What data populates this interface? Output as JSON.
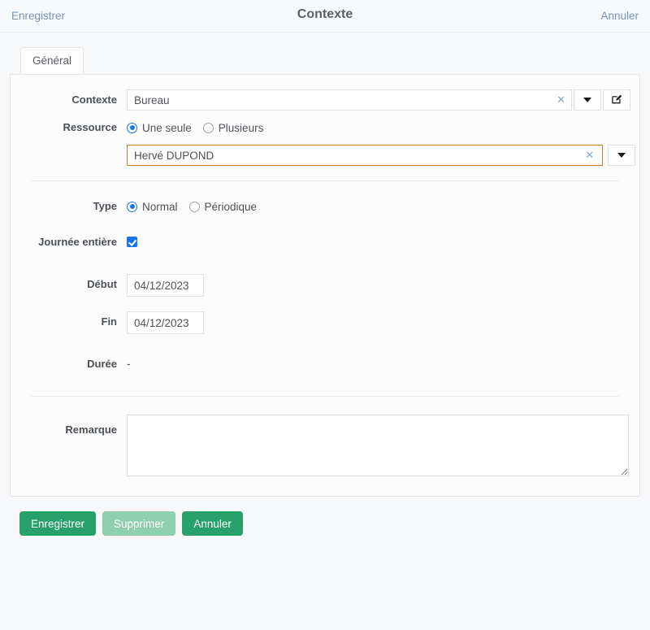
{
  "header": {
    "save_link": "Enregistrer",
    "title": "Contexte",
    "cancel_link": "Annuler"
  },
  "tabs": [
    {
      "label": "Général",
      "active": true
    }
  ],
  "form": {
    "contexte": {
      "label": "Contexte",
      "value": "Bureau",
      "clear_icon": "clear-x-icon",
      "dropdown_icon": "chevron-down-icon",
      "edit_icon": "edit-pencil-icon"
    },
    "ressource": {
      "label": "Ressource",
      "options": [
        {
          "label": "Une seule",
          "selected": true
        },
        {
          "label": "Plusieurs",
          "selected": false
        }
      ],
      "value": "Hervé DUPOND",
      "placeholder": "",
      "clear_icon": "clear-x-icon",
      "dropdown_icon": "chevron-down-icon",
      "focus_border_color": "#c87f29"
    },
    "type": {
      "label": "Type",
      "options": [
        {
          "label": "Normal",
          "selected": true
        },
        {
          "label": "Périodique",
          "selected": false
        }
      ]
    },
    "journee_entiere": {
      "label": "Journée entière",
      "checked": true,
      "accent_color": "#1a73e8"
    },
    "debut": {
      "label": "Début",
      "value": "04/12/2023"
    },
    "fin": {
      "label": "Fin",
      "value": "04/12/2023"
    },
    "duree": {
      "label": "Durée",
      "value": "-"
    },
    "remarque": {
      "label": "Remarque",
      "value": "",
      "placeholder": ""
    }
  },
  "footer": {
    "buttons": [
      {
        "label": "Enregistrer",
        "style": "primary"
      },
      {
        "label": "Supprimer",
        "style": "muted"
      },
      {
        "label": "Annuler",
        "style": "primary"
      }
    ]
  },
  "colors": {
    "page_background": "#f7f8f9",
    "panel_background": "#fcfcfd",
    "accent_blue": "#1a73e8",
    "link_blue": "#7593b8",
    "button_green": "#27a06a",
    "button_green_disabled": "#8fcfb0",
    "focus_orange": "#c87f29"
  }
}
